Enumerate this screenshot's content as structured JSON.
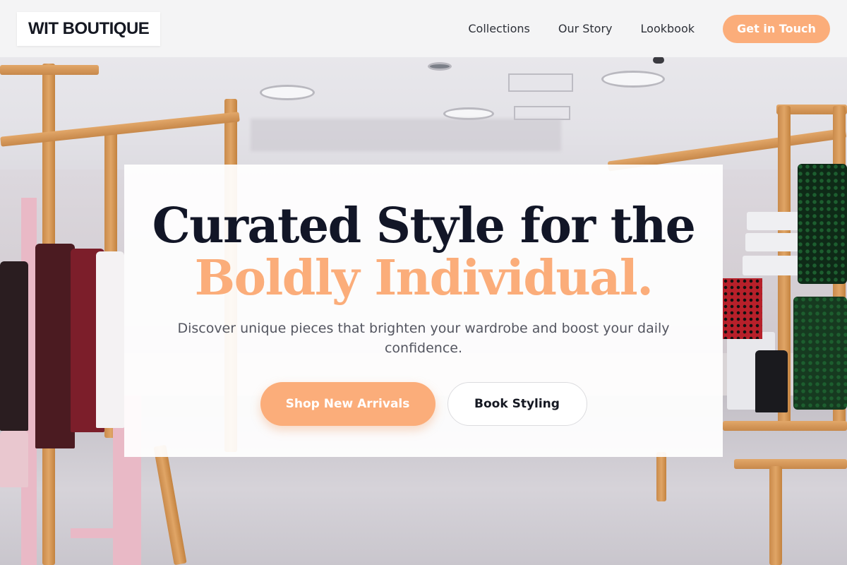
{
  "brand": {
    "logo": "WIT BOUTIQUE"
  },
  "nav": {
    "links": [
      "Collections",
      "Our Story",
      "Lookbook"
    ],
    "cta": "Get in Touch"
  },
  "hero": {
    "headline_line1": "Curated Style for the",
    "headline_line2": "Boldly Individual.",
    "subtext": "Discover unique pieces that brighten your wardrobe and boost your daily confidence.",
    "primary_button": "Shop New Arrivals",
    "secondary_button": "Book Styling"
  },
  "colors": {
    "accent": "#fbad7a",
    "headline": "#121627",
    "header_bg": "#f4f4f5"
  }
}
